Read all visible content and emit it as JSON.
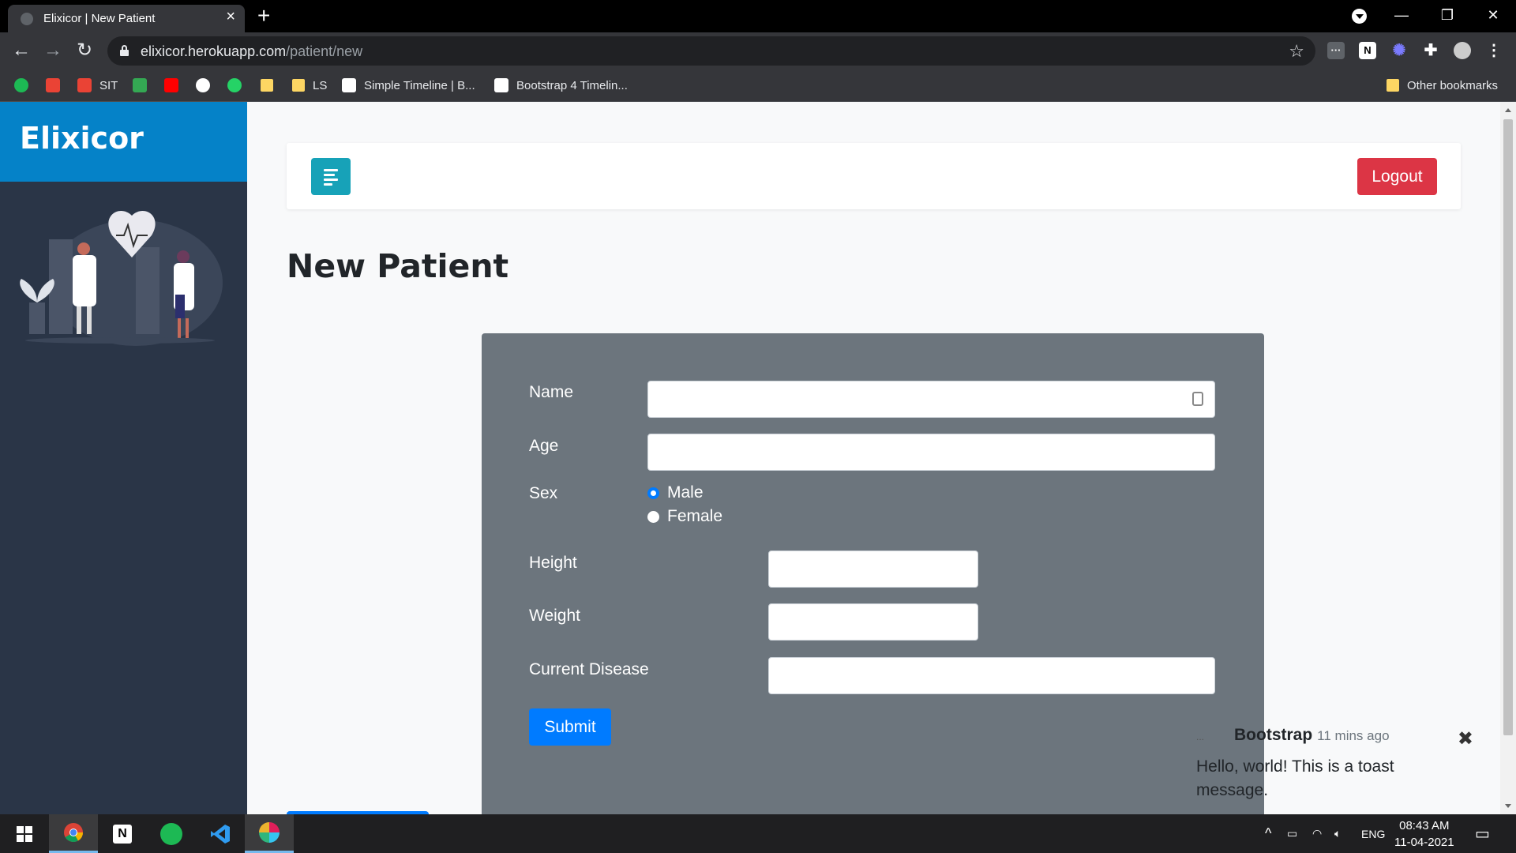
{
  "browser": {
    "tab_title": "Elixicor | New Patient",
    "url_host": "elixicor.herokuapp.com",
    "url_path": "/patient/new",
    "bookmarks": [
      {
        "label": "SIT"
      },
      {
        "label": "LS"
      },
      {
        "label": "Simple Timeline | B..."
      },
      {
        "label": "Bootstrap 4 Timelin..."
      }
    ],
    "other_bookmarks": "Other bookmarks"
  },
  "sidebar": {
    "brand": "Elixicor"
  },
  "header": {
    "logout_label": "Logout"
  },
  "main": {
    "title": "New Patient",
    "form": {
      "name_label": "Name",
      "age_label": "Age",
      "sex_label": "Sex",
      "sex_options": [
        "Male",
        "Female"
      ],
      "sex_selected": "Male",
      "height_label": "Height",
      "weight_label": "Weight",
      "disease_label": "Current Disease",
      "submit_label": "Submit"
    }
  },
  "toast": {
    "title": "Bootstrap",
    "time": "11 mins ago",
    "message": "Hello, world! This is a toast message.",
    "broken_image_text": "..."
  },
  "taskbar": {
    "language": "ENG",
    "time": "08:43 AM",
    "date": "11-04-2021"
  },
  "colors": {
    "brand_blue": "#0582c8",
    "sidebar_bg": "#2a3547",
    "menu_btn": "#17a2b8",
    "logout_btn": "#dc3545",
    "form_card": "#6c757d",
    "submit_btn": "#007bff"
  }
}
